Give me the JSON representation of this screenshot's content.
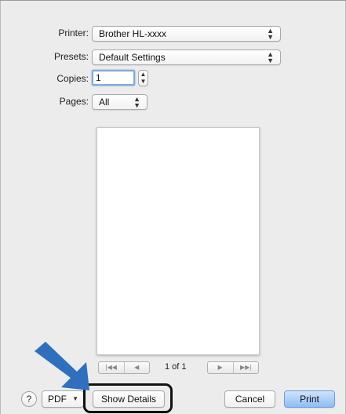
{
  "printer": {
    "label": "Printer:",
    "value": "Brother HL-xxxx"
  },
  "presets": {
    "label": "Presets:",
    "value": "Default Settings"
  },
  "copies": {
    "label": "Copies:",
    "value": "1"
  },
  "pages": {
    "label": "Pages:",
    "value": "All"
  },
  "preview": {
    "page_indicator": "1 of 1"
  },
  "nav": {
    "first_icon": "first-page-icon",
    "prev_icon": "previous-page-icon",
    "next_icon": "next-page-icon",
    "last_icon": "last-page-icon"
  },
  "footer": {
    "help_label": "?",
    "pdf_label": "PDF",
    "show_details_label": "Show Details",
    "cancel_label": "Cancel",
    "print_label": "Print"
  },
  "colors": {
    "annotation_arrow": "#2f6fbd",
    "highlight_ring": "#111111",
    "default_button": "#8fbcf2"
  }
}
